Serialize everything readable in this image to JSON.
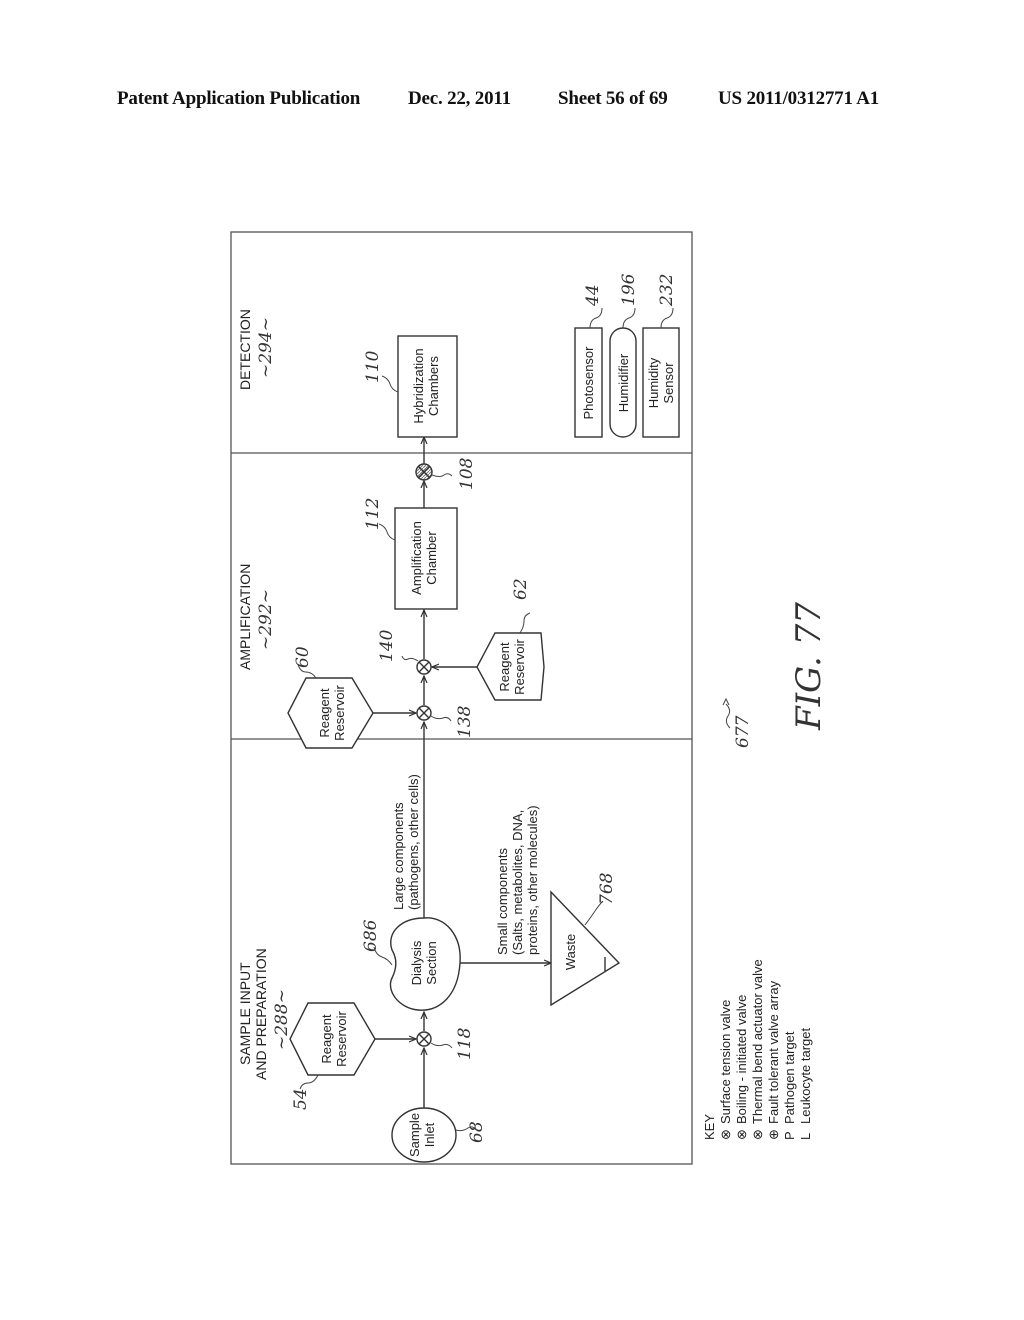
{
  "header": {
    "publication": "Patent Application Publication",
    "date": "Dec. 22, 2011",
    "sheet": "Sheet 56 of 69",
    "number": "US 2011/0312771 A1"
  },
  "figure": {
    "label": "FIG. 77",
    "ref": "677",
    "sections": [
      {
        "title": [
          "SAMPLE INPUT",
          "AND PREPARATION"
        ],
        "ref": "~288~"
      },
      {
        "title": [
          "AMPLIFICATION"
        ],
        "ref": "~292~"
      },
      {
        "title": [
          "DETECTION"
        ],
        "ref": "~294~"
      }
    ],
    "nodes": {
      "sample_inlet": {
        "lines": [
          "Sample",
          "Inlet"
        ],
        "ref": "68"
      },
      "reagent_54": {
        "lines": [
          "Reagent",
          "Reservoir"
        ],
        "ref": "54"
      },
      "valve_118": {
        "ref": "118"
      },
      "dialysis": {
        "lines": [
          "Dialysis",
          "Section"
        ],
        "ref": "686"
      },
      "waste": {
        "lines": [
          "Waste"
        ],
        "ref": "768"
      },
      "reagent_60": {
        "lines": [
          "Reagent",
          "Reservoir"
        ],
        "ref": "60"
      },
      "reagent_62": {
        "lines": [
          "Reagent",
          "Reservoir"
        ],
        "ref": "62"
      },
      "valve_138": {
        "ref": "138"
      },
      "valve_140": {
        "ref": "140"
      },
      "amplification": {
        "lines": [
          "Amplification",
          "Chamber"
        ],
        "ref": "112"
      },
      "valve_108": {
        "ref": "108"
      },
      "hybridization": {
        "lines": [
          "Hybridization",
          "Chambers"
        ],
        "ref": "110"
      },
      "photosensor": {
        "lines": [
          "Photosensor"
        ],
        "ref": "44"
      },
      "humidifier": {
        "lines": [
          "Humidifier"
        ],
        "ref": "196"
      },
      "humidity_sensor": {
        "lines": [
          "Humidity",
          "Sensor"
        ],
        "ref": "232"
      }
    },
    "flow_labels": {
      "large": [
        "Large components",
        "(pathogens, other cells)"
      ],
      "small": [
        "Small components",
        "(Salts, metabolites, DNA,",
        "proteins, other molecules)"
      ]
    },
    "key": {
      "title": "KEY",
      "items": [
        {
          "symbol": "⊗",
          "label": "Surface tension valve"
        },
        {
          "symbol": "⊗",
          "label": "Boiling - initiated valve"
        },
        {
          "symbol": "⊗",
          "label": "Thermal bend actuator valve"
        },
        {
          "symbol": "⊕",
          "label": "Fault tolerant valve array"
        },
        {
          "symbol": "P",
          "label": "Pathogen target"
        },
        {
          "symbol": "L",
          "label": "Leukocyte target"
        }
      ]
    }
  }
}
